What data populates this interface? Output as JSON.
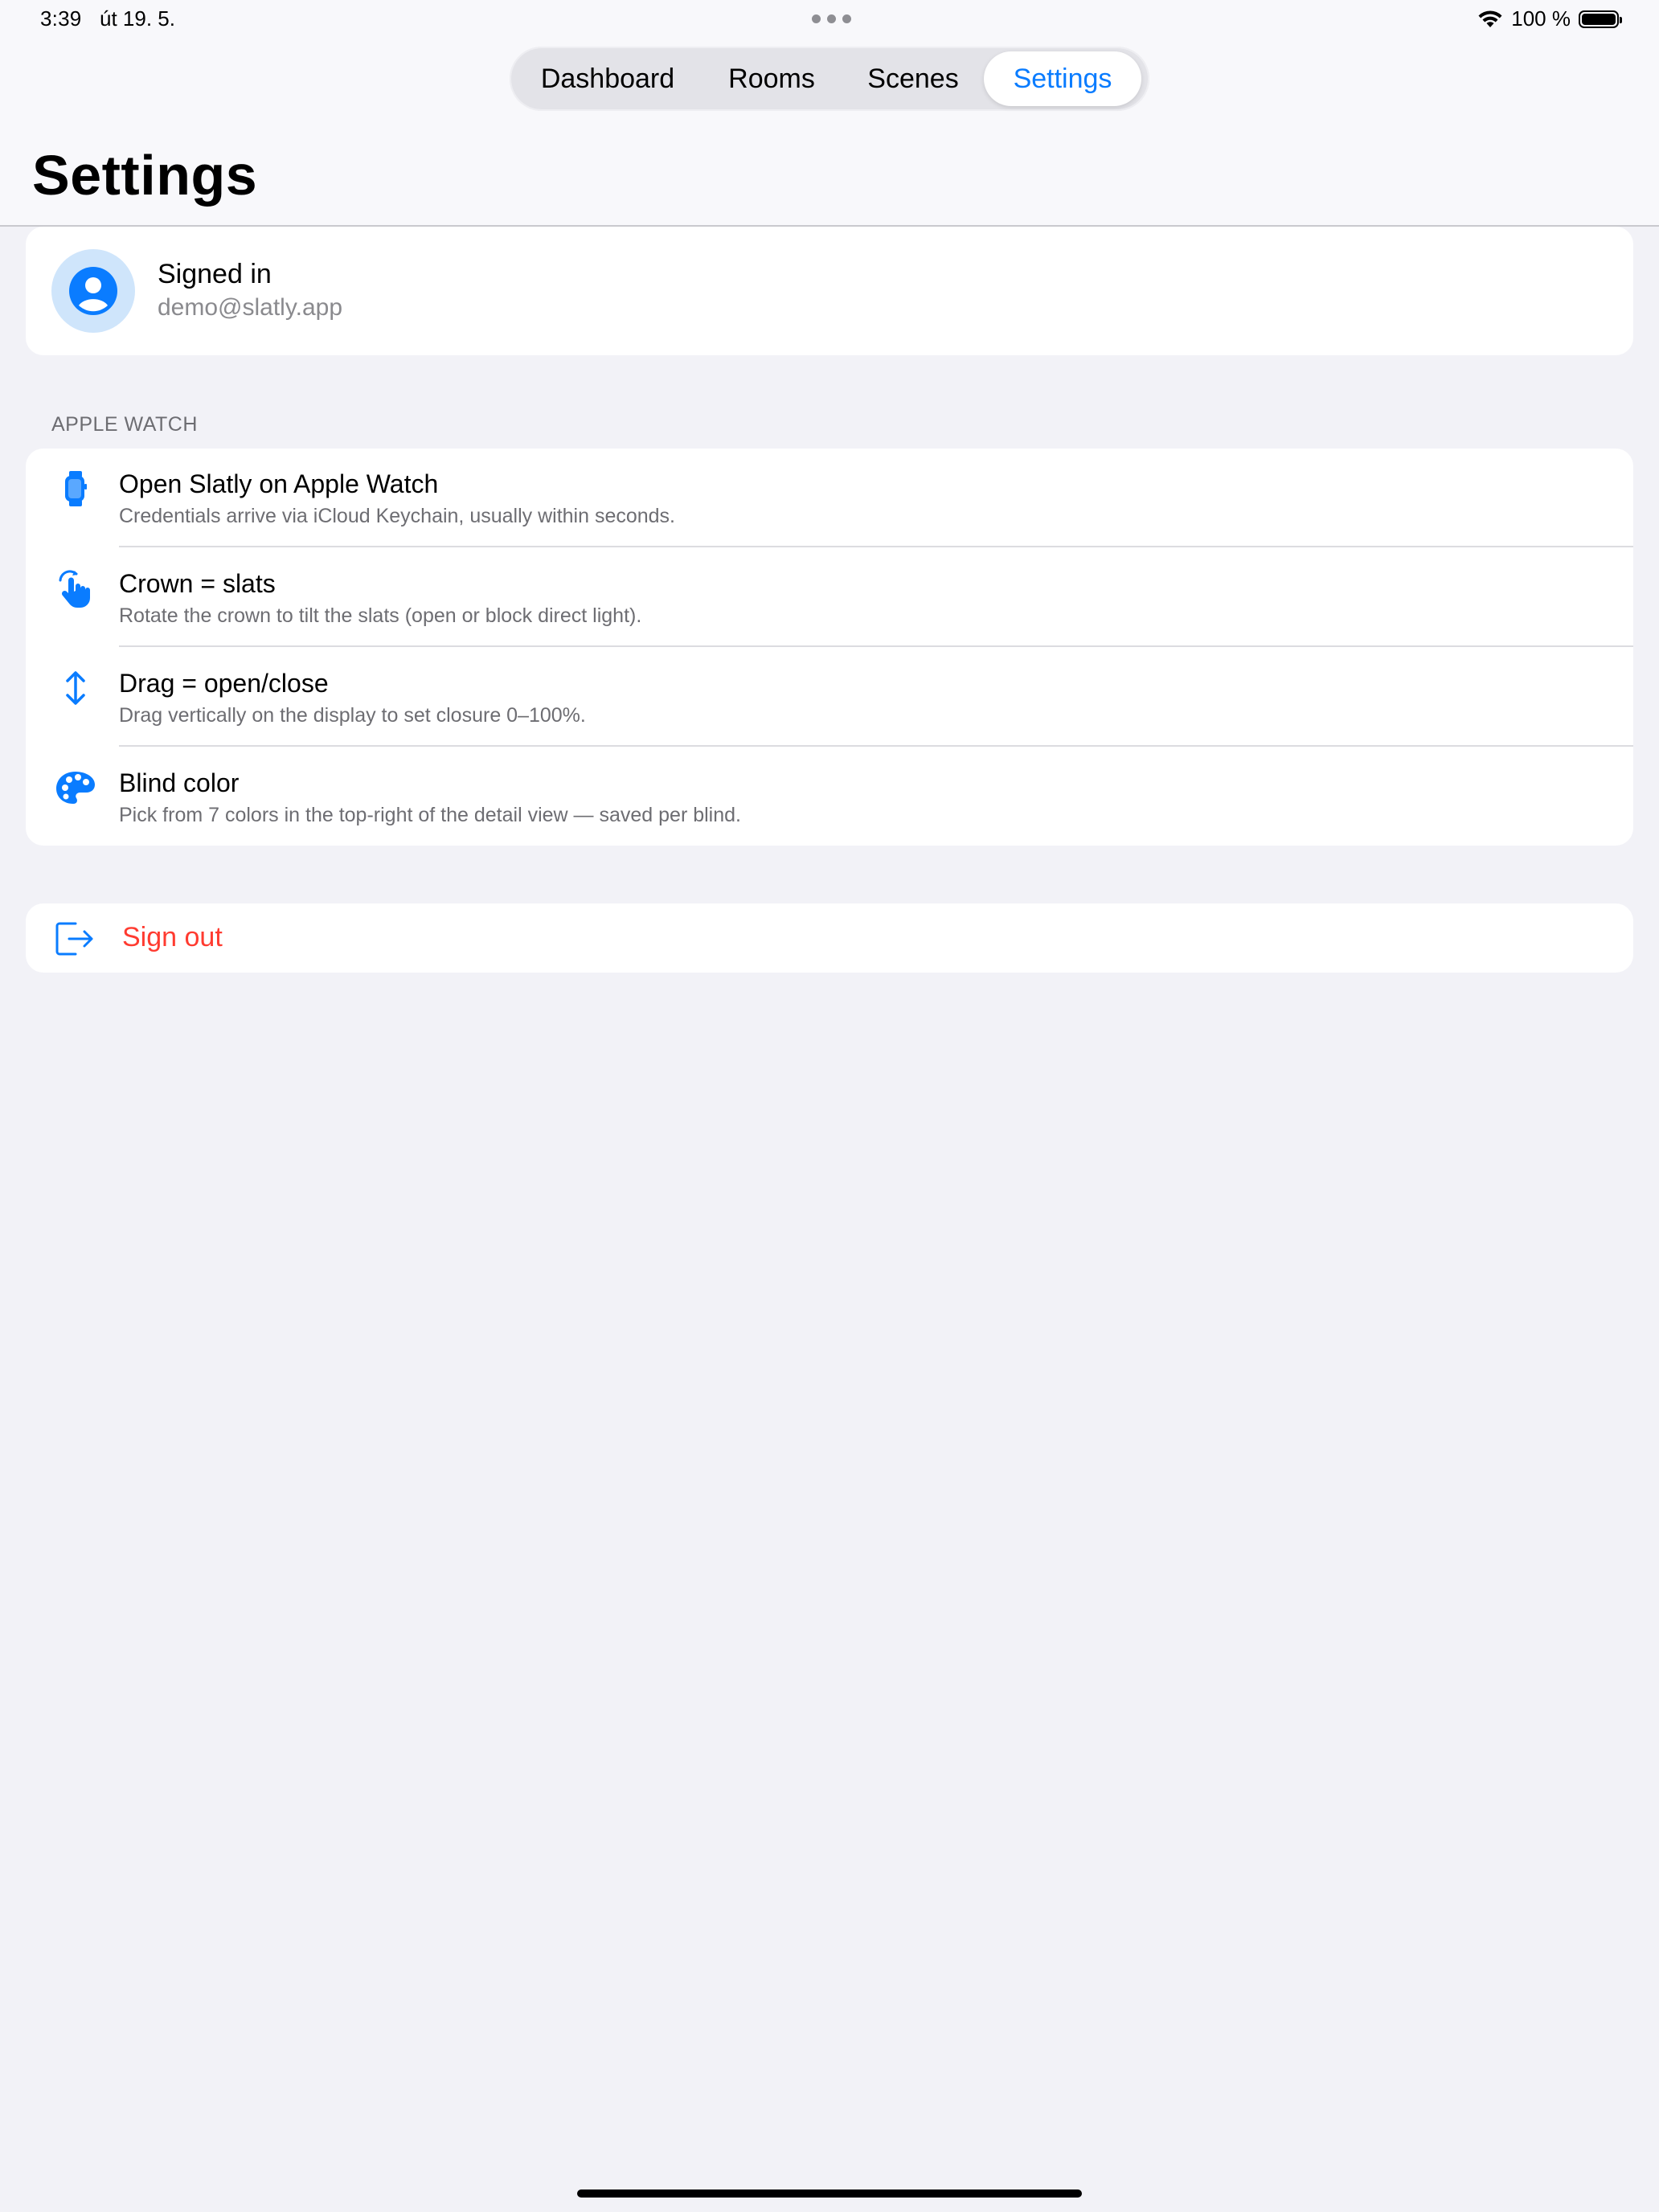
{
  "status_bar": {
    "time": "3:39",
    "date": "út 19. 5.",
    "battery": "100 %",
    "battery_level": 1.0
  },
  "tabs": [
    {
      "label": "Dashboard",
      "active": false
    },
    {
      "label": "Rooms",
      "active": false
    },
    {
      "label": "Scenes",
      "active": false
    },
    {
      "label": "Settings",
      "active": true
    }
  ],
  "page": {
    "title": "Settings"
  },
  "account": {
    "status": "Signed in",
    "email": "demo@slatly.app",
    "icon": "person-circle-icon"
  },
  "apple_watch": {
    "header": "APPLE WATCH",
    "items": [
      {
        "title": "Open Slatly on Apple Watch",
        "description": "Credentials arrive via iCloud Keychain, usually within seconds.",
        "icon": "applewatch-icon"
      },
      {
        "title": "Crown = slats",
        "description": "Rotate the crown to tilt the slats (open or block direct light).",
        "icon": "hand-rotate-icon"
      },
      {
        "title": "Drag = open/close",
        "description": "Drag vertically on the display to set closure 0–100%.",
        "icon": "arrow-up-down-icon"
      },
      {
        "title": "Blind color",
        "description": "Pick from 7 colors in the top-right of the detail view — saved per blind.",
        "icon": "palette-icon"
      }
    ]
  },
  "sign_out": {
    "label": "Sign out",
    "icon": "sign-out-icon"
  },
  "colors": {
    "accent": "#0a7cff",
    "destructive": "#ff3b30",
    "background": "#f2f2f7",
    "secondary_text": "#6d6d72"
  }
}
